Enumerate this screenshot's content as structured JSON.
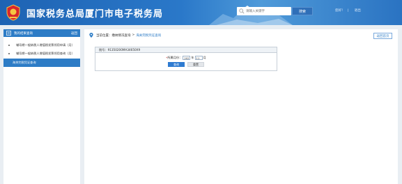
{
  "header": {
    "title": "国家税务总局厦门市电子税务局",
    "search_placeholder": "请输入关键字",
    "search_button": "搜索",
    "user_name": "您好！",
    "user_separator": "|",
    "exit_label": "退出"
  },
  "sidebar": {
    "title": "我的结果查询",
    "more": "返回",
    "items": [
      {
        "label": "辅导期一般纳税人增值税发票领用申请（月）"
      },
      {
        "label": "辅导期一般纳税人增值税发票领用查询（月）"
      },
      {
        "label": "海关完税凭证查询"
      }
    ]
  },
  "main": {
    "breadcrumb_prefix": "当前位置：",
    "breadcrumb_parent": "缴纳情况查询",
    "breadcrumb_sep": ">",
    "breadcrumb_current": "海关完税凭证查询",
    "back_button": "返回首页",
    "panel_header": "税号：91350200MA34650X9",
    "date_label": "所属月份",
    "year_value": "2023",
    "year_unit": "年",
    "month_value": "11",
    "month_unit": "月",
    "query_button": "查询",
    "reset_button": "重置"
  },
  "colors": {
    "header_blue": "#1e63b3",
    "accent_blue": "#2d7cc6",
    "page_bg": "#e9eef3"
  }
}
